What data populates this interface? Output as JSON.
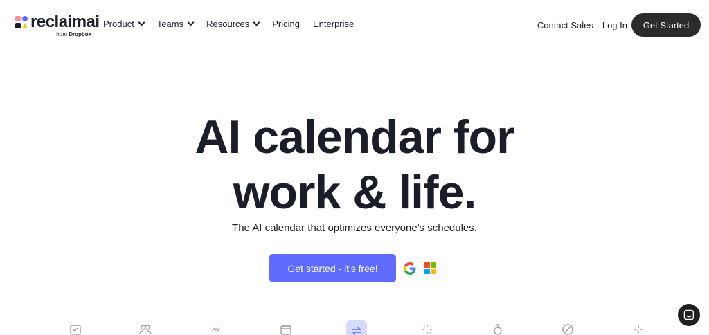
{
  "brand": {
    "name": "reclaimai",
    "sub_prefix": "from",
    "sub_brand": "Dropbox"
  },
  "nav": {
    "menu": [
      {
        "label": "Product",
        "dropdown": true
      },
      {
        "label": "Teams",
        "dropdown": true
      },
      {
        "label": "Resources",
        "dropdown": true
      },
      {
        "label": "Pricing",
        "dropdown": false
      },
      {
        "label": "Enterprise",
        "dropdown": false
      }
    ],
    "contact_sales": "Contact Sales",
    "login": "Log In",
    "get_started": "Get Started"
  },
  "hero": {
    "title_line1": "AI calendar for",
    "title_line2": "work & life.",
    "subtitle": "The AI calendar that optimizes everyone's schedules.",
    "cta": "Get started - it's free!"
  },
  "integrations": [
    "google-icon",
    "microsoft-icon"
  ],
  "features": [
    {
      "icon": "shield-check-icon",
      "active": false
    },
    {
      "icon": "users-icon",
      "active": false
    },
    {
      "icon": "link-icon",
      "active": false
    },
    {
      "icon": "calendar-icon",
      "active": false
    },
    {
      "icon": "sync-icon",
      "active": true
    },
    {
      "icon": "loading-icon",
      "active": false
    },
    {
      "icon": "timer-icon",
      "active": false
    },
    {
      "icon": "slash-circle-icon",
      "active": false
    },
    {
      "icon": "sparkle-icon",
      "active": false
    }
  ],
  "colors": {
    "primary": "#5f6bff",
    "dark_button": "#2b2b2d",
    "text": "#1b1d29",
    "active_feature_bg": "#d7daff"
  }
}
